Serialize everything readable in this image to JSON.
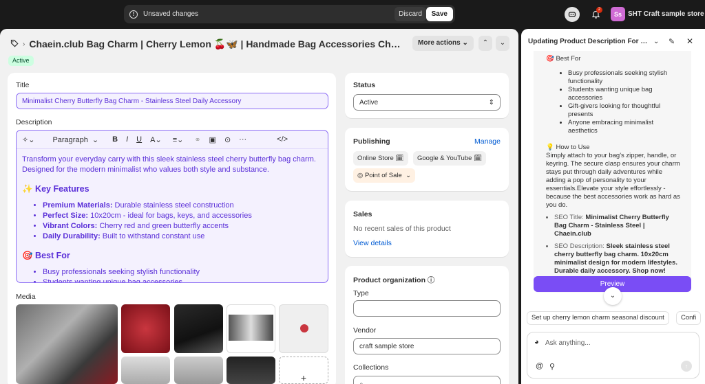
{
  "topbar": {
    "unsaved_text": "Unsaved changes",
    "discard_label": "Discard",
    "save_label": "Save",
    "notifications_count": "2",
    "store_initials": "Ss",
    "store_name": "SHT Craft sample store"
  },
  "product": {
    "breadcrumb_icon": "tag-icon",
    "title": "Chaein.club Bag Charm | Cherry Lemon 🍒🦋 | Handmade Bag Accessories Cherry ...",
    "more_actions": "More actions",
    "status_badge": "Active"
  },
  "title_section": {
    "label": "Title",
    "value": "Minimalist Cherry Butterfly Bag Charm - Stainless Steel Daily Accessory"
  },
  "description": {
    "label": "Description",
    "paragraph_select": "Paragraph",
    "intro": "Transform your everyday carry with this sleek stainless steel cherry butterfly bag charm. Designed for the modern minimalist who values both style and substance.",
    "features_heading": "✨ Key Features",
    "features": [
      {
        "bold": "Premium Materials:",
        "text": " Durable stainless steel construction"
      },
      {
        "bold": "Perfect Size:",
        "text": " 10x20cm - ideal for bags, keys, and accessories"
      },
      {
        "bold": "Vibrant Colors:",
        "text": " Cherry red and green butterfly accents"
      },
      {
        "bold": "Daily Durability:",
        "text": " Built to withstand constant use"
      }
    ],
    "best_for_heading": "🎯 Best For",
    "best_for": [
      "Busy professionals seeking stylish functionality",
      "Students wanting unique bag accessories"
    ]
  },
  "media": {
    "label": "Media",
    "add_symbol": "+"
  },
  "status": {
    "label": "Status",
    "value": "Active"
  },
  "publishing": {
    "label": "Publishing",
    "manage": "Manage",
    "channels": [
      "Online Store",
      "Google & YouTube",
      "Point of Sale"
    ]
  },
  "sales": {
    "label": "Sales",
    "text": "No recent sales of this product",
    "link": "View details"
  },
  "organization": {
    "label": "Product organization",
    "type_label": "Type",
    "type_value": "",
    "vendor_label": "Vendor",
    "vendor_value": "craft sample store",
    "collections_label": "Collections"
  },
  "panel": {
    "title": "Updating Product Description For B...",
    "best_for_heading": "🎯 Best For",
    "best_for": [
      "Busy professionals seeking stylish functionality",
      "Students wanting unique bag accessories",
      "Gift-givers looking for thoughtful presents",
      "Anyone embracing minimalist aesthetics"
    ],
    "how_to_heading": "💡 How to Use",
    "how_to_text": "Simply attach to your bag's zipper, handle, or keyring. The secure clasp ensures your charm stays put through daily adventures while adding a pop of personality to your essentials.Elevate your style effortlessly - because the best accessories work as hard as you do.",
    "seo_title_label": "SEO Title: ",
    "seo_title_value": "Minimalist Cherry Butterfly Bag Charm - Stainless Steel | Chaein.club",
    "seo_desc_label": "SEO Description: ",
    "seo_desc_value": "Sleek stainless steel cherry butterfly bag charm. 10x20cm minimalist design for modern lifestyles. Durable daily accessory. Shop now!",
    "preview_label": "Preview",
    "suggestions": [
      "Set up cherry lemon charm seasonal discount",
      "Confi"
    ],
    "ask_placeholder": "Ask anything..."
  },
  "colors": {
    "accent": "#7a4df5",
    "link": "#005bd3",
    "active_badge": "#cdfee1"
  }
}
